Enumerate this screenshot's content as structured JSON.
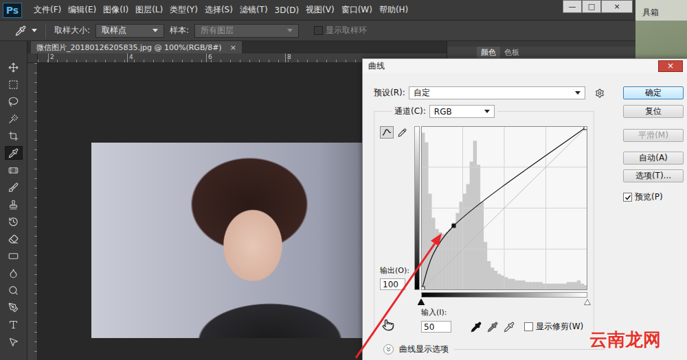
{
  "app": {
    "logo": "Ps",
    "menu": [
      "文件(F)",
      "编辑(E)",
      "图像(I)",
      "图层(L)",
      "类型(Y)",
      "选择(S)",
      "滤镜(T)",
      "3D(D)",
      "视图(V)",
      "窗口(W)",
      "帮助(H)"
    ],
    "window_controls": [
      "—",
      "□",
      "×"
    ]
  },
  "background_window": {
    "text": "具箱"
  },
  "options_bar": {
    "sample_size_label": "取样大小:",
    "sample_size": "取样点",
    "sample_label": "样本:",
    "sample": "所有图层",
    "sample_disabled": true,
    "show_ring": {
      "label": "显示取样环",
      "checked": false,
      "disabled": true
    }
  },
  "tools": [
    {
      "selected": false
    },
    {
      "selected": false
    },
    {
      "selected": false
    },
    {
      "selected": false
    },
    {
      "selected": false
    },
    {
      "selected": true
    },
    {
      "selected": false
    },
    {
      "selected": false
    },
    {
      "selected": false
    },
    {
      "selected": false
    },
    {
      "selected": false
    },
    {
      "selected": false
    },
    {
      "selected": false
    },
    {
      "selected": false
    },
    {
      "selected": false
    },
    {
      "selected": false
    },
    {
      "selected": false
    }
  ],
  "document_tab": {
    "title": "微信图片_20180126205835.jpg @ 100%(RGB/8#)",
    "close": "×"
  },
  "ruler": {
    "ticks": [
      "2",
      "4",
      "6",
      "8"
    ]
  },
  "panel_tabs": [
    {
      "label": "颜色",
      "selected": true
    },
    {
      "label": "色板",
      "selected": false
    }
  ],
  "curves_dialog": {
    "title": "曲线",
    "close": "×",
    "preset_label": "预设(R):",
    "preset": "自定",
    "channel_label": "通道(C):",
    "channel": "RGB",
    "tools": [
      {
        "selected": true
      },
      {
        "selected": false
      }
    ],
    "output_label": "输出(O):",
    "output": "100",
    "input_label": "输入(I):",
    "input": "50",
    "show_clipping": {
      "label": "显示修剪(W)",
      "checked": false
    },
    "display_options": "曲线显示选项",
    "buttons": [
      {
        "label": "确定",
        "default": true,
        "disabled": false
      },
      {
        "label": "复位",
        "default": false,
        "disabled": false
      },
      {
        "label": "平滑(M)",
        "default": false,
        "disabled": true
      },
      {
        "label": "自动(A)",
        "default": false,
        "disabled": false
      },
      {
        "label": "选项(T)...",
        "default": false,
        "disabled": false
      }
    ],
    "preview": {
      "label": "预览(P)",
      "checked": true
    },
    "curve": {
      "points": [
        [
          0,
          0
        ],
        [
          50,
          100
        ],
        [
          255,
          255
        ]
      ],
      "selected_point": 1
    },
    "histogram": [
      98,
      92,
      60,
      45,
      38,
      36,
      35,
      36,
      38,
      42,
      48,
      55,
      60,
      66,
      80,
      93,
      78,
      55,
      30,
      18,
      14,
      12,
      10,
      9,
      8,
      7,
      7,
      6,
      6,
      6,
      5,
      5,
      5,
      5,
      5,
      4,
      4,
      4,
      4,
      4,
      4,
      4,
      5,
      5,
      5,
      6,
      4,
      3
    ]
  },
  "watermark": "云南龙网"
}
